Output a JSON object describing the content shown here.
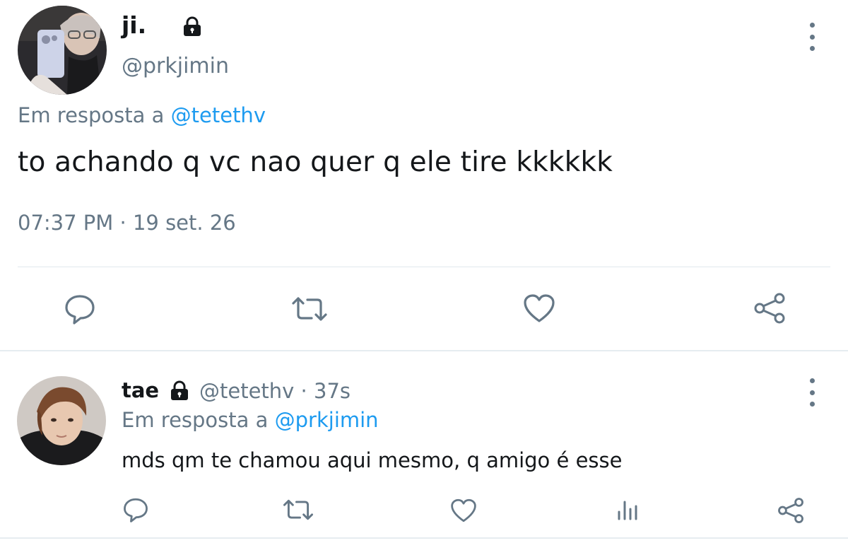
{
  "main_tweet": {
    "display_name": "ji.",
    "handle": "@prkjimin",
    "reply_prefix": "Em resposta a ",
    "reply_to": "@tetethv",
    "text": "to achando q vc nao quer q ele tire kkkkkk",
    "timestamp": "07:37 PM · 19 set. 26",
    "actions": [
      "reply",
      "retweet",
      "like",
      "share"
    ]
  },
  "reply_tweet": {
    "display_name": "tae",
    "handle_time": "@tetethv · 37s",
    "reply_prefix": "Em resposta a ",
    "reply_to": "@prkjimin",
    "text": "mds qm te chamou aqui mesmo, q amigo é esse",
    "actions": [
      "reply",
      "retweet",
      "like",
      "analytics",
      "share"
    ]
  },
  "icons": {
    "lock": "lock-icon",
    "more": "more-vertical-icon",
    "reply": "comment-icon",
    "retweet": "retweet-icon",
    "like": "heart-icon",
    "share": "share-icon",
    "analytics": "bar-chart-icon"
  },
  "colors": {
    "text": "#14171a",
    "secondary": "#657786",
    "link": "#1d9bf0",
    "divider": "#e1e8ed"
  }
}
